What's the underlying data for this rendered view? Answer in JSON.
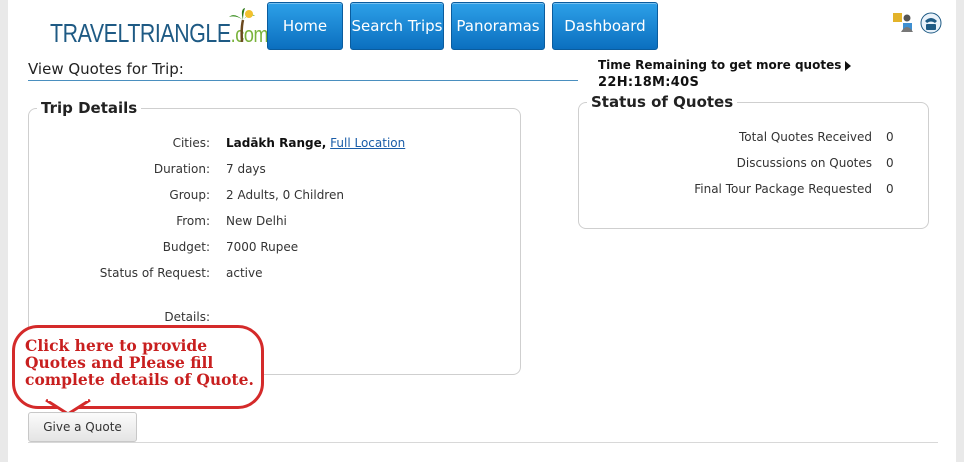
{
  "header": {
    "logo_main": "TRAVELTRIANGLE",
    "logo_suffix": ".com",
    "nav": [
      {
        "label": "Home"
      },
      {
        "label": "Search Trips"
      },
      {
        "label": "Panoramas"
      },
      {
        "label": "Dashboard"
      }
    ]
  },
  "page_title": "View Quotes for Trip:",
  "timer": {
    "label": "Time Remaining to get more quotes",
    "countdown": "22H:18M:40S"
  },
  "trip_details": {
    "legend": "Trip Details",
    "rows": [
      {
        "label": "Cities:",
        "value": "Ladākh Range,",
        "link": "Full Location"
      },
      {
        "label": "Duration:",
        "value": "7 days"
      },
      {
        "label": "Group:",
        "value": "2 Adults, 0 Children"
      },
      {
        "label": "From:",
        "value": "New Delhi"
      },
      {
        "label": "Budget:",
        "value": "7000 Rupee"
      },
      {
        "label": "Status of Request:",
        "value": "active"
      },
      {
        "label": "Details:",
        "value": ""
      }
    ]
  },
  "quote_status": {
    "legend": "Status of Quotes",
    "rows": [
      {
        "label": "Total Quotes Received",
        "value": "0"
      },
      {
        "label": "Discussions on Quotes",
        "value": "0"
      },
      {
        "label": "Final Tour Package Requested",
        "value": "0"
      }
    ]
  },
  "callout": {
    "text": "Click here to provide Quotes and Please fill complete details of Quote."
  },
  "give_quote_label": "Give a Quote",
  "colors": {
    "nav_blue": "#1587d6",
    "callout_red": "#d42a2a",
    "link_blue": "#1a5da8"
  }
}
